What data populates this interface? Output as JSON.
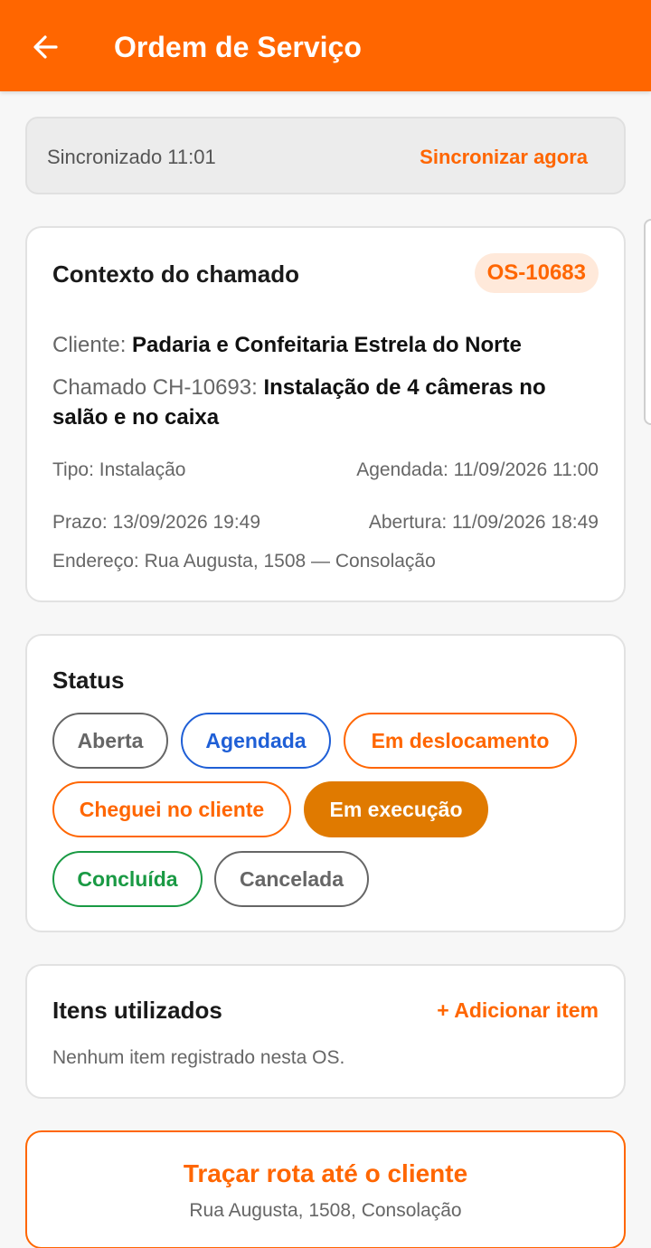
{
  "header": {
    "title": "Ordem de Serviço",
    "back_icon": "arrow-left-icon"
  },
  "sync": {
    "status": "Sincronizado 11:01",
    "action": "Sincronizar agora"
  },
  "context": {
    "title": "Contexto do chamado",
    "os_number": "OS-10683",
    "client_label": "Cliente: ",
    "client_value": "Padaria e Confeitaria Estrela do Norte",
    "ticket_label": "Chamado CH-10693: ",
    "ticket_value": "Instalação de 4 câmeras no salão e no caixa",
    "type": "Tipo: Instalação",
    "scheduled": "Agendada: 11/09/2026 11:00",
    "deadline": "Prazo: 13/09/2026 19:49",
    "opened": "Abertura: 11/09/2026 18:49",
    "address": "Endereço: Rua Augusta, 1508 — Consolação"
  },
  "status": {
    "title": "Status",
    "options": [
      "Aberta",
      "Agendada",
      "Em deslocamento",
      "Cheguei no cliente",
      "Em execução",
      "Concluída",
      "Cancelada"
    ],
    "selected": "Em execução"
  },
  "items": {
    "title": "Itens utilizados",
    "add_label": "+ Adicionar item",
    "empty_text": "Nenhum item registrado nesta OS."
  },
  "route": {
    "title": "Traçar rota até o cliente",
    "address": "Rua Augusta, 1508, Consolação"
  },
  "colors": {
    "primary": "#ff6600",
    "selected_status": "#e07a00",
    "blue": "#1f5fd6",
    "green": "#1a9a44",
    "gray": "#666666"
  }
}
